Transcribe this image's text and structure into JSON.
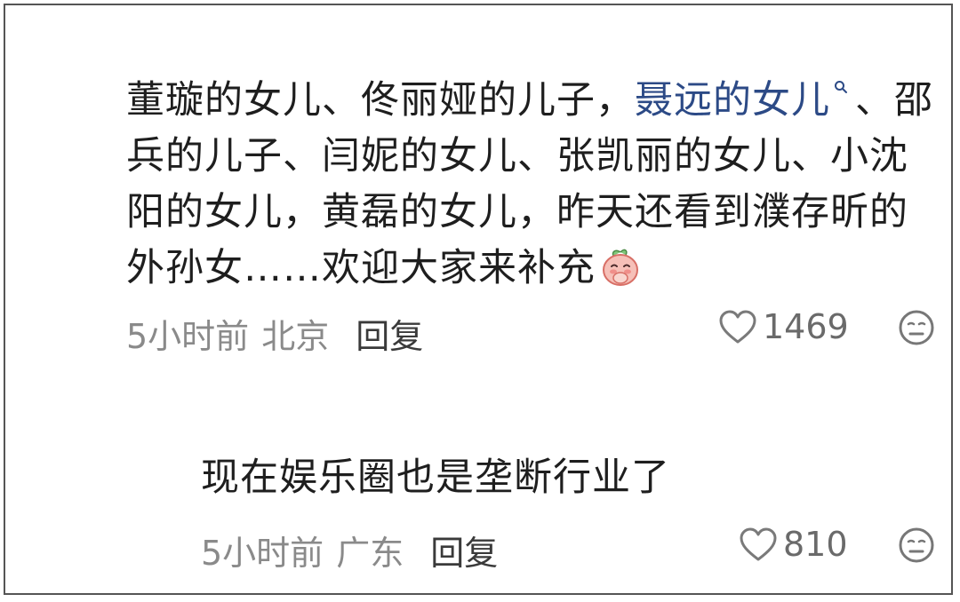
{
  "comments": [
    {
      "text_before": "董璇的女儿、佟丽娅的儿子，",
      "search_link": "聂远的女儿",
      "text_after": "、邵兵的儿子、闫妮的女儿、张凯丽的女儿、小沈阳的女儿，黄磊的女儿，昨天还看到濮存昕的外孙女……欢迎大家来补充",
      "time": "5小时前",
      "location": "北京",
      "reply_label": "回复",
      "likes": "1469"
    },
    {
      "text": "现在娱乐圈也是垄断行业了",
      "time": "5小时前",
      "location": "广东",
      "reply_label": "回复",
      "likes": "810"
    }
  ],
  "icons": {
    "like": "heart-outline-icon",
    "reaction": "neutral-face-icon",
    "search": "search-icon",
    "emoji": "peach-cover-mouth-emoji"
  },
  "colors": {
    "link": "#2c4a86",
    "meta": "#8a8a8a",
    "text": "#1e1e1e"
  }
}
